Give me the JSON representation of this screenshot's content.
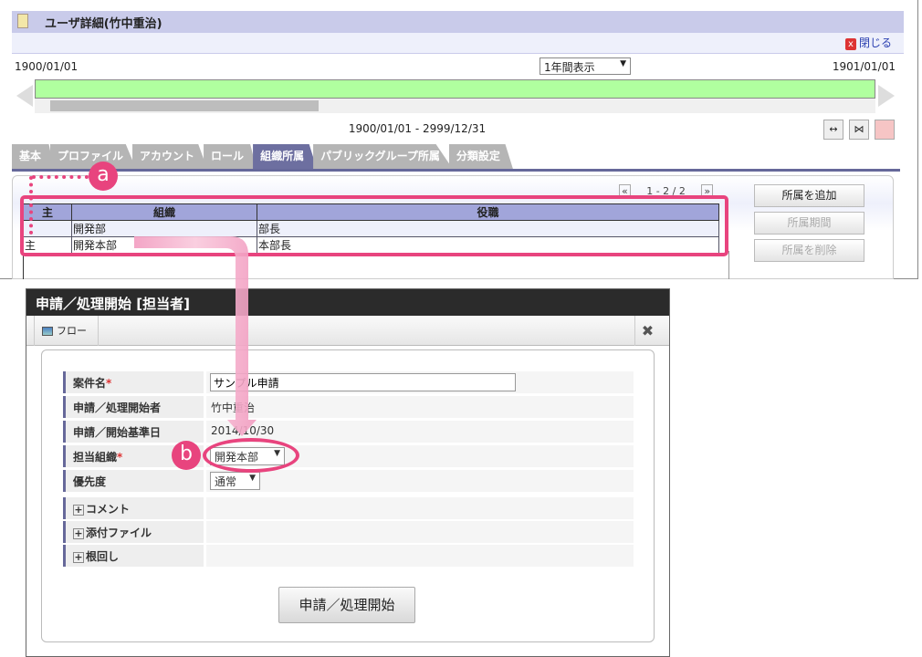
{
  "window": {
    "title": "ユーザ詳細(竹中重治)",
    "close_label": "閉じる"
  },
  "timeline": {
    "start": "1900/01/01",
    "end": "1901/01/01",
    "view_select": "1年間表示",
    "range": "1900/01/01 - 2999/12/31"
  },
  "tabs": [
    {
      "label": "基本"
    },
    {
      "label": "プロファイル"
    },
    {
      "label": "アカウント"
    },
    {
      "label": "ロール"
    },
    {
      "label": "組織所属",
      "active": true
    },
    {
      "label": "パブリックグループ所属"
    },
    {
      "label": "分類設定"
    }
  ],
  "pager": {
    "text": "1 - 2 / 2",
    "prev": "«",
    "next": "»"
  },
  "table": {
    "headers": [
      "主",
      "組織",
      "役職"
    ],
    "rows": [
      [
        "",
        "開発部",
        "部長"
      ],
      [
        "主",
        "開発本部",
        "本部長"
      ]
    ]
  },
  "side_buttons": [
    "所属を追加",
    "所属期間",
    "所属を削除"
  ],
  "dialog": {
    "title": "申請／処理開始 [担当者]",
    "flow_label": "フロー",
    "close_icon": "✖",
    "fields": [
      {
        "label": "案件名",
        "required": true,
        "value": "サンプル申請"
      },
      {
        "label": "申請／処理開始者",
        "value": "竹中重治"
      },
      {
        "label": "申請／開始基準日",
        "value": "2014/10/30"
      },
      {
        "label": "担当組織",
        "required": true,
        "value": "開発本部"
      },
      {
        "label": "優先度",
        "value": "通常"
      }
    ],
    "sections": [
      "コメント",
      "添付ファイル",
      "根回し"
    ],
    "submit_label": "申請／処理開始"
  },
  "annotations": {
    "a": "a",
    "b": "b",
    "color": "#e8447e"
  }
}
